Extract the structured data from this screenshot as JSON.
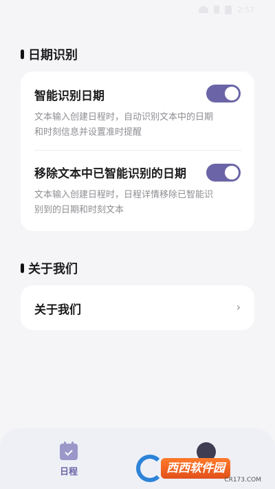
{
  "status_bar": {
    "time": "2:57"
  },
  "date_section": {
    "title": "日期识别",
    "items": [
      {
        "title": "智能识别日期",
        "desc_line1": "文本输入创建日程时，自动识别文本中的日期",
        "desc_line2": "和时刻信息并设置准时提醒",
        "enabled": true
      },
      {
        "title": "移除文本中已智能识别的日期",
        "desc_line1": "文本输入创建日程时，日程详情移除已智能识",
        "desc_line2": "别到的日期和时刻文本",
        "enabled": true
      }
    ]
  },
  "about_section": {
    "title": "关于我们",
    "item_label": "关于我们",
    "chevron": "›"
  },
  "bottom_nav": {
    "schedule_label": "日程"
  },
  "watermark": {
    "brand": "西西软件园",
    "site": "CR173.COM"
  },
  "colors": {
    "accent": "#6b65a7",
    "background": "#f5f5f7",
    "card": "#ffffff"
  }
}
